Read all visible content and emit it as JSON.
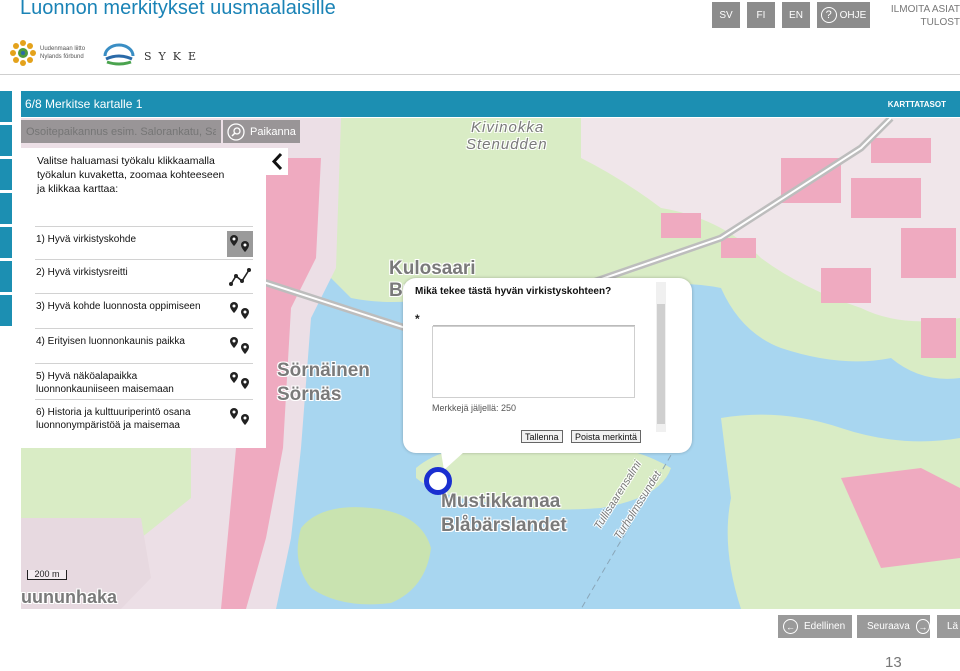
{
  "header": {
    "title": "Luonnon merkitykset uusmaalaisille",
    "languages": [
      "SV",
      "FI",
      "EN"
    ],
    "help_label": "OHJE",
    "report_label": "ILMOITA ASIAT",
    "print_label": "TULOST"
  },
  "logos": {
    "uusimaa_line1": "Uudenmaan liitto",
    "uusimaa_line2": "Nylands förbund",
    "syke": "SYKE"
  },
  "step": {
    "title": "6/8 Merkitse kartalle 1",
    "layers_label": "KARTTATASOT"
  },
  "search": {
    "placeholder": "Osoitepaikannus esim. Salorankatu, Salo",
    "button_label": "Paikanna"
  },
  "tools": {
    "intro": "Valitse haluamasi työkalu klikkaamalla työkalun kuvaketta, zoomaa kohteeseen ja klikkaa karttaa:",
    "items": [
      {
        "label": "1) Hyvä virkistyskohde",
        "icon": "point-marker-icon"
      },
      {
        "label": "2) Hyvä virkistysreitti",
        "icon": "route-line-icon"
      },
      {
        "label": "3) Hyvä kohde luonnosta oppimiseen",
        "icon": "point-marker-icon"
      },
      {
        "label": "4) Erityisen luonnonkaunis paikka",
        "icon": "point-marker-icon"
      },
      {
        "label": "5) Hyvä näköalapaikka luonnonkauniiseen maisemaan",
        "icon": "point-marker-icon"
      },
      {
        "label": "6) Historia ja kulttuuriperintö osana luonnonympäristöä ja maisemaa",
        "icon": "point-marker-icon"
      }
    ]
  },
  "map": {
    "labels": {
      "kivinokka": "Kivinokka",
      "stenudden": "Stenudden",
      "kulosaari": "Kulosaari",
      "kulosaari_sv": "Br",
      "sornainen": "Sörnäinen",
      "sornas": "Sörnäs",
      "mustikkamaa": "Mustikkamaa",
      "blabarslandet": "Blåbärslandet",
      "tullisaarensalmi": "Tullisaarensalmi",
      "turholmssundet": "Turholmssundet",
      "kruununhaka": "uununhaka"
    },
    "scale": "200 m"
  },
  "popup": {
    "question": "Mikä tekee tästä hyvän virkistyskohteen?",
    "required_mark": "*",
    "answer_value": "",
    "counter_label": "Merkkejä jäljellä: 250",
    "save_label": "Tallenna",
    "delete_label": "Poista merkintä"
  },
  "nav": {
    "prev_label": "Edellinen",
    "next_label": "Seuraava",
    "last_label": "Lä"
  },
  "page_number": "13"
}
